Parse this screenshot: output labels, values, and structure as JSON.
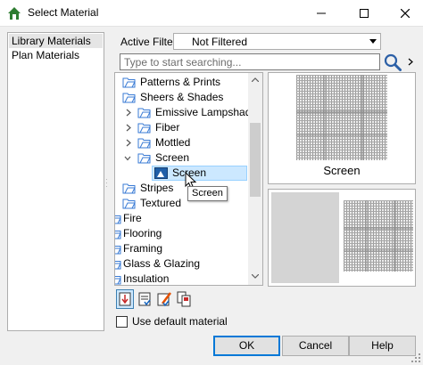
{
  "window": {
    "title": "Select Material",
    "icons": {
      "app": "chief-architect-icon",
      "minimize": "minimize-icon",
      "maximize": "maximize-icon",
      "close": "close-icon"
    }
  },
  "library_list": {
    "items": [
      {
        "label": "Library Materials",
        "selected": true
      },
      {
        "label": "Plan Materials",
        "selected": false
      }
    ]
  },
  "filter": {
    "label": "Active Filter:",
    "value": "Not Filtered"
  },
  "search": {
    "placeholder": "Type to start searching...",
    "value": ""
  },
  "tree": {
    "rows": [
      {
        "label": "Patterns & Prints",
        "icon": "folder-icon",
        "expander": "none"
      },
      {
        "label": "Sheers & Shades",
        "icon": "folder-icon",
        "expander": "none"
      },
      {
        "label": "Emissive Lampshade",
        "icon": "folder-icon",
        "expander": "collapsed"
      },
      {
        "label": "Fiber",
        "icon": "folder-icon",
        "expander": "collapsed"
      },
      {
        "label": "Mottled",
        "icon": "folder-icon",
        "expander": "collapsed"
      },
      {
        "label": "Screen",
        "icon": "folder-icon",
        "expander": "expanded"
      },
      {
        "label": "Screen",
        "icon": "material-icon",
        "expander": "none",
        "selected": true
      },
      {
        "label": "Stripes",
        "icon": "folder-icon",
        "expander": "none"
      },
      {
        "label": "Textured",
        "icon": "folder-icon",
        "expander": "none"
      },
      {
        "label": "Fire",
        "icon": "folder-icon",
        "expander": "none"
      },
      {
        "label": "Flooring",
        "icon": "folder-icon",
        "expander": "none"
      },
      {
        "label": "Framing",
        "icon": "folder-icon",
        "expander": "none"
      },
      {
        "label": "Glass & Glazing",
        "icon": "folder-icon",
        "expander": "none"
      },
      {
        "label": "Insulation",
        "icon": "folder-icon",
        "expander": "none"
      }
    ],
    "tooltip": "Screen"
  },
  "preview": {
    "caption": "Screen"
  },
  "toolbar": {
    "buttons": [
      {
        "icon": "sort-library-icon",
        "pressed": true
      },
      {
        "icon": "show-list-icon",
        "pressed": false
      },
      {
        "icon": "edit-material-icon",
        "pressed": false
      },
      {
        "icon": "add-to-library-icon",
        "pressed": false
      }
    ]
  },
  "options": {
    "use_default_label": "Use default material",
    "use_default_checked": false
  },
  "buttons": {
    "ok": "OK",
    "cancel": "Cancel",
    "help": "Help"
  },
  "colors": {
    "selection": "#cce8ff",
    "folder_blue": "#3a7bd5",
    "default_button_border": "#0078d7"
  }
}
